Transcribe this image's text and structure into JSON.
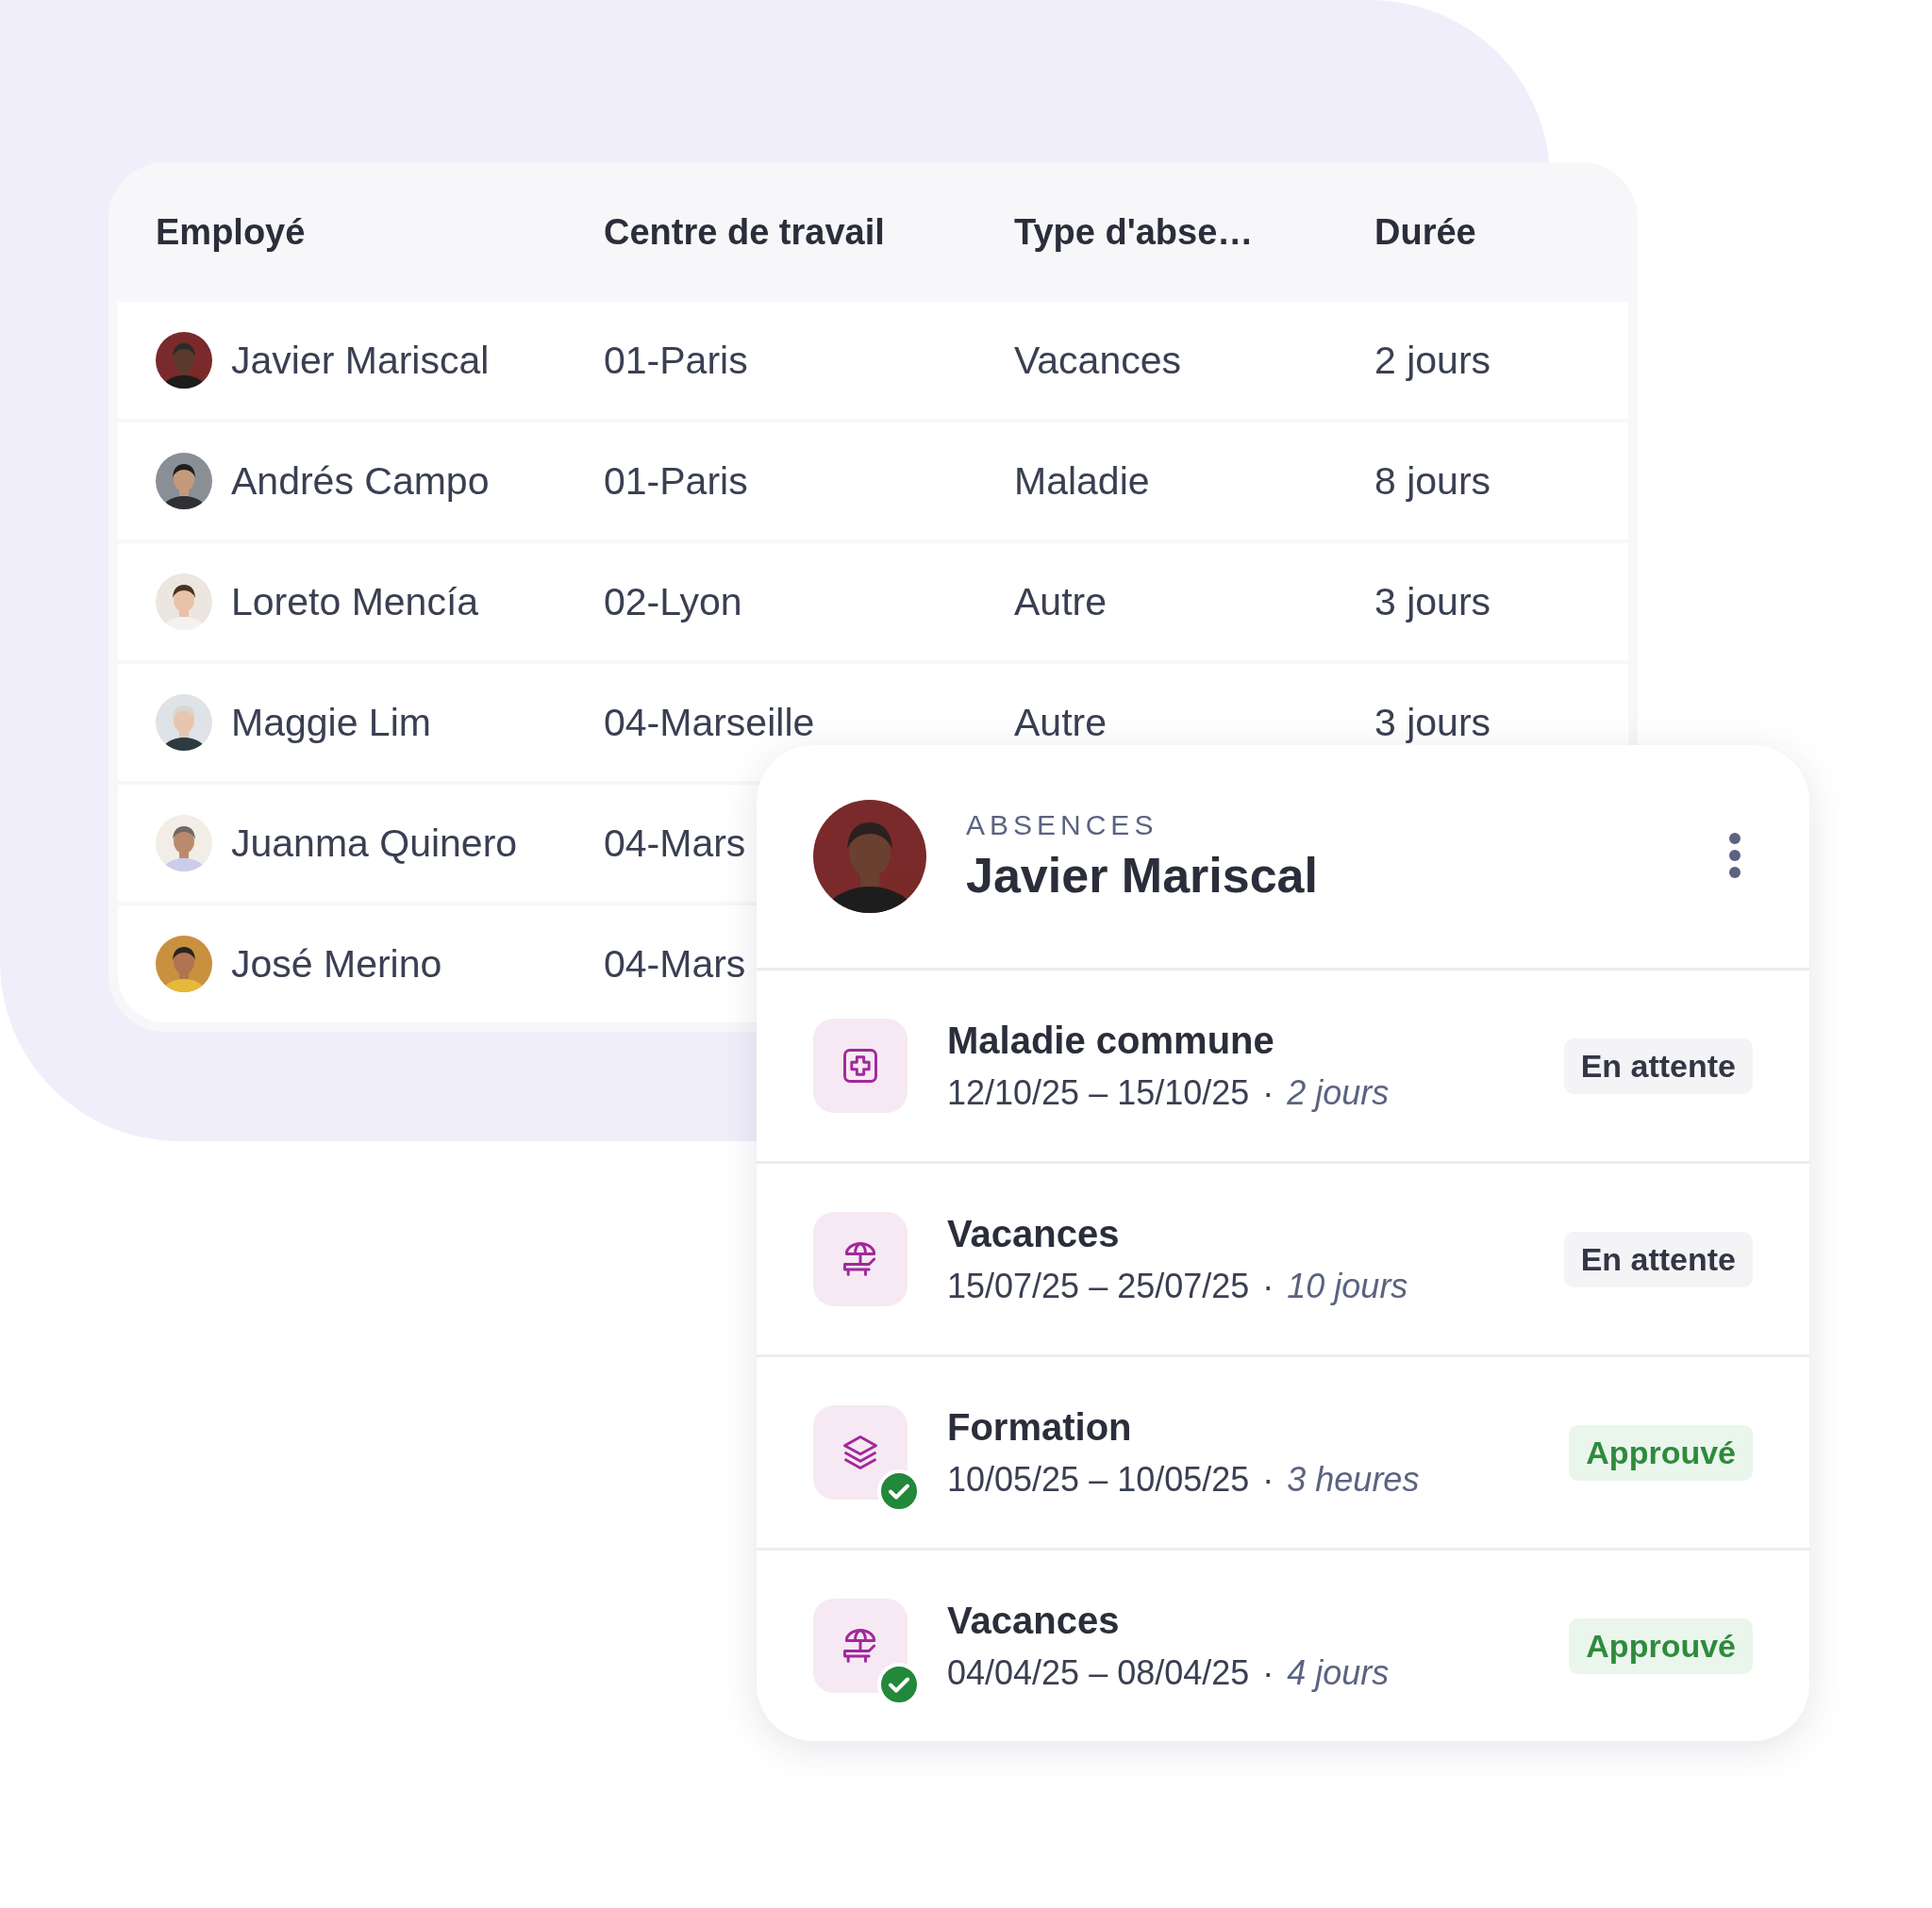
{
  "table": {
    "columns": [
      "Employé",
      "Centre de travail",
      "Type d'abse…",
      "Durée"
    ],
    "rows": [
      {
        "employee": "Javier Mariscal",
        "work_center": "01-Paris",
        "absence_type": "Vacances",
        "duration": "2 jours"
      },
      {
        "employee": "Andrés Campo",
        "work_center": "01-Paris",
        "absence_type": "Maladie",
        "duration": "8 jours"
      },
      {
        "employee": "Loreto Mencía",
        "work_center": "02-Lyon",
        "absence_type": "Autre",
        "duration": "3 jours"
      },
      {
        "employee": "Maggie Lim",
        "work_center": "04-Marseille",
        "absence_type": "Autre",
        "duration": "3 jours"
      },
      {
        "employee": "Juanma Quinero",
        "work_center": "04-Mars"
      },
      {
        "employee": "José Merino",
        "work_center": "04-Mars"
      }
    ]
  },
  "absence_card": {
    "section_label": "ABSENCES",
    "employee_name": "Javier Mariscal",
    "absences": [
      {
        "kind": "illness",
        "title": "Maladie commune",
        "dates": "12/10/25 – 15/10/25",
        "separator": "·",
        "duration": "2 jours",
        "status": "En attente",
        "approved": false
      },
      {
        "kind": "vacation",
        "title": "Vacances",
        "dates": "15/07/25 – 25/07/25",
        "separator": "·",
        "duration": "10 jours",
        "status": "En attente",
        "approved": false
      },
      {
        "kind": "training",
        "title": "Formation",
        "dates": "10/05/25 – 10/05/25",
        "separator": "·",
        "duration": "3 heures",
        "status": "Approuvé",
        "approved": true
      },
      {
        "kind": "vacation",
        "title": "Vacances",
        "dates": "04/04/25 – 08/04/25",
        "separator": "·",
        "duration": "4 jours",
        "status": "Approuvé",
        "approved": true
      }
    ]
  }
}
